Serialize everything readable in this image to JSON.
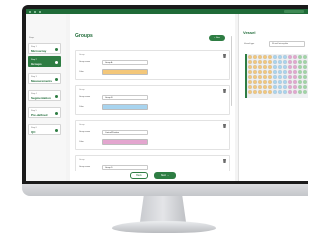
{
  "sidebar": {
    "label": "Steps",
    "steps": [
      {
        "num": "Step 1",
        "name": "Microarray"
      },
      {
        "num": "Step 2",
        "name": "Groups"
      },
      {
        "num": "Step 3",
        "name": "Measurements"
      },
      {
        "num": "Step 4",
        "name": "Segmentation"
      },
      {
        "num": "Step 5",
        "name": "Pre-defined"
      },
      {
        "num": "Step 6",
        "name": "QC"
      }
    ]
  },
  "main": {
    "title": "Groups",
    "new_button": "+ New",
    "group_label": "Group",
    "group_name_label": "Group name",
    "color_label": "Color",
    "groups": [
      {
        "name": "Group A",
        "color": "#f3c77a"
      },
      {
        "name": "Group B",
        "color": "#a8d4ef"
      },
      {
        "name": "Control/Positive",
        "color": "#e3a6cf"
      },
      {
        "name": "Group D",
        "color": "#ffffff"
      }
    ]
  },
  "footer": {
    "back_label": "Back",
    "next_label": "Next →"
  },
  "vessel": {
    "title": "Vessel",
    "select_label": "Vessel type",
    "select_value": "96-well microplate",
    "wells": {
      "rows": 8,
      "cols": 12
    },
    "well_colors": [
      "#f3c77a",
      "#a8d4ef",
      "#e3a6cf",
      "#9fd6a5"
    ]
  },
  "colors": {
    "accent": "#2e7d43",
    "accent_dark": "#1f6b38"
  }
}
